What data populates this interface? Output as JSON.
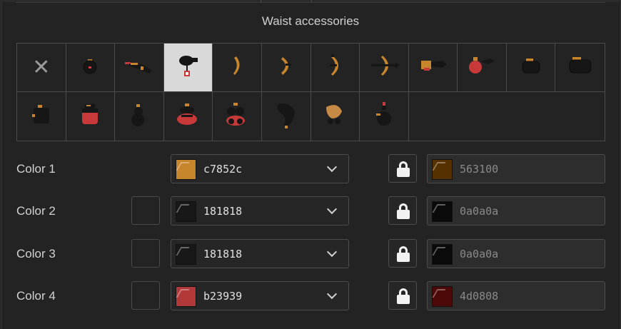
{
  "section_title": "Waist accessories",
  "accessories": [
    {
      "name": "none-icon"
    },
    {
      "name": "round-pouch-icon"
    },
    {
      "name": "quiver-arrows-icon"
    },
    {
      "name": "black-pouch-tag-icon",
      "selected": true
    },
    {
      "name": "bow-small-icon"
    },
    {
      "name": "bow-strung-icon"
    },
    {
      "name": "bow-curved-icon"
    },
    {
      "name": "bow-arrow-icon"
    },
    {
      "name": "crossbow-bolt-icon"
    },
    {
      "name": "red-flask-feather-icon"
    },
    {
      "name": "belt-pack-icon"
    },
    {
      "name": "belt-pack-large-icon"
    },
    {
      "name": "satchel-icon"
    },
    {
      "name": "red-satchel-icon"
    },
    {
      "name": "double-pouch-icon"
    },
    {
      "name": "red-double-pouch-icon"
    },
    {
      "name": "red-triple-pouch-icon"
    },
    {
      "name": "fur-pelt-icon"
    },
    {
      "name": "tan-pelt-icon"
    },
    {
      "name": "hanging-flask-icon"
    }
  ],
  "color_rows": [
    {
      "label": "Color 1",
      "value": "c7852c",
      "shade": "563100",
      "swatch": "#c7852c",
      "shade_swatch": "#563100",
      "has_mini": false
    },
    {
      "label": "Color 2",
      "value": "181818",
      "shade": "0a0a0a",
      "swatch": "#181818",
      "shade_swatch": "#0a0a0a",
      "has_mini": true
    },
    {
      "label": "Color 3",
      "value": "181818",
      "shade": "0a0a0a",
      "swatch": "#181818",
      "shade_swatch": "#0a0a0a",
      "has_mini": true
    },
    {
      "label": "Color 4",
      "value": "b23939",
      "shade": "4d0808",
      "swatch": "#b23939",
      "shade_swatch": "#4d0808",
      "has_mini": true
    }
  ]
}
